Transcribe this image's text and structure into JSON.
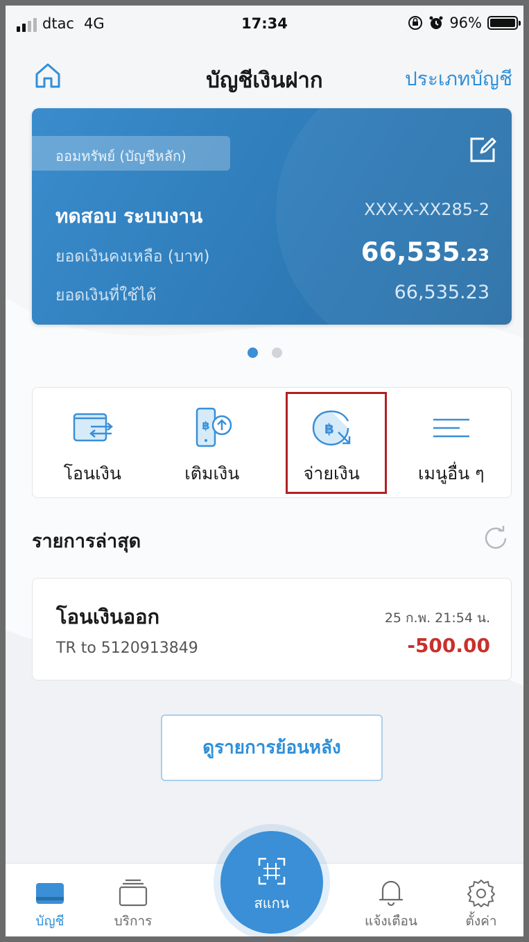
{
  "status_bar": {
    "carrier": "dtac",
    "network": "4G",
    "time": "17:34",
    "battery": "96%",
    "icons": [
      "signal-icon",
      "rotation-lock-icon",
      "alarm-icon",
      "battery-icon"
    ]
  },
  "header": {
    "title": "บัญชีเงินฝาก",
    "account_type_link": "ประเภทบัญชี",
    "home_icon": "home-icon"
  },
  "account_card": {
    "account_type": "ออมทรัพย์ (บัญชีหลัก)",
    "account_name": "ทดสอบ ระบบงาน",
    "account_number": "XXX-X-XX285-2",
    "balance_label": "ยอดเงินคงเหลือ (บาท)",
    "balance_integer": "66,535",
    "balance_decimal": ".23",
    "available_label": "ยอดเงินที่ใช้ได้",
    "available_value": "66,535.23",
    "edit_icon": "edit-icon",
    "colors": {
      "card_start": "#3a8ccc",
      "card_end": "#2a6fa6"
    }
  },
  "pagination": {
    "total": 2,
    "active_index": 0
  },
  "actions": [
    {
      "label": "โอนเงิน",
      "icon": "transfer-icon"
    },
    {
      "label": "เติมเงิน",
      "icon": "topup-icon"
    },
    {
      "label": "จ่ายเงิน",
      "icon": "pay-icon",
      "highlighted": true
    },
    {
      "label": "เมนูอื่น ๆ",
      "icon": "menu-icon"
    }
  ],
  "recent": {
    "title": "รายการล่าสุด",
    "refresh_icon": "refresh-icon",
    "transactions": [
      {
        "title": "โอนเงินออก",
        "datetime": "25 ก.พ. 21:54 น.",
        "description": "TR to 5120913849",
        "amount": "-500.00"
      }
    ],
    "history_button": "ดูรายการย้อนหลัง"
  },
  "tabbar": {
    "tabs": [
      {
        "label": "บัญชี",
        "icon": "account-icon",
        "active": true
      },
      {
        "label": "บริการ",
        "icon": "services-icon",
        "active": false
      },
      {
        "label": "สแกน",
        "icon": "scan-icon",
        "active": false
      },
      {
        "label": "แจ้งเตือน",
        "icon": "bell-icon",
        "active": false
      },
      {
        "label": "ตั้งค่า",
        "icon": "gear-icon",
        "active": false
      }
    ]
  },
  "colors": {
    "accent": "#2f8fd8",
    "negative_amount": "#c9302c",
    "highlight_border": "#b02124"
  }
}
